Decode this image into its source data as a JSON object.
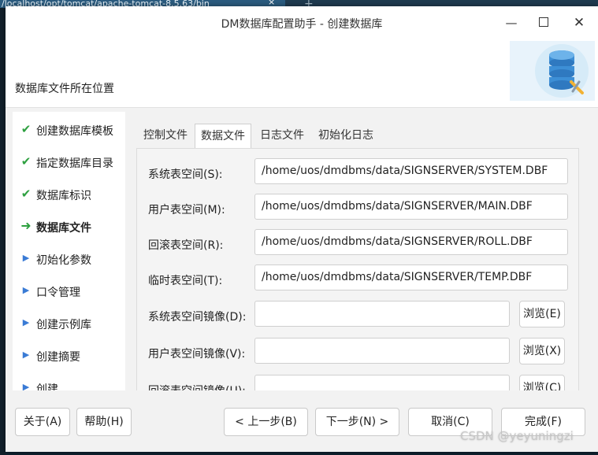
{
  "terminal": {
    "tab_title": "/localhost/opt/tomcat/apache-tomcat-8.5.63/bin",
    "tab_close": "×",
    "new_tab": "+"
  },
  "window": {
    "title": "DM数据库配置助手 - 创建数据库",
    "minimize": "—",
    "close": "✕"
  },
  "header": {
    "label": "数据库文件所在位置"
  },
  "steps": [
    {
      "label": "创建数据库模板",
      "state": "done",
      "icon": "✔"
    },
    {
      "label": "指定数据库目录",
      "state": "done",
      "icon": "✔"
    },
    {
      "label": "数据库标识",
      "state": "done",
      "icon": "✔"
    },
    {
      "label": "数据库文件",
      "state": "current",
      "icon": "➜"
    },
    {
      "label": "初始化参数",
      "state": "todo",
      "icon": "▶"
    },
    {
      "label": "口令管理",
      "state": "todo",
      "icon": "▶"
    },
    {
      "label": "创建示例库",
      "state": "todo",
      "icon": "▶"
    },
    {
      "label": "创建摘要",
      "state": "todo",
      "icon": "▶"
    },
    {
      "label": "创建",
      "state": "todo",
      "icon": "▶"
    }
  ],
  "tabs": [
    {
      "label": "控制文件"
    },
    {
      "label": "数据文件"
    },
    {
      "label": "日志文件"
    },
    {
      "label": "初始化日志"
    }
  ],
  "fields": [
    {
      "label": "系统表空间(S):",
      "value": "/home/uos/dmdbms/data/SIGNSERVER/SYSTEM.DBF"
    },
    {
      "label": "用户表空间(M):",
      "value": "/home/uos/dmdbms/data/SIGNSERVER/MAIN.DBF"
    },
    {
      "label": "回滚表空间(R):",
      "value": "/home/uos/dmdbms/data/SIGNSERVER/ROLL.DBF"
    },
    {
      "label": "临时表空间(T):",
      "value": "/home/uos/dmdbms/data/SIGNSERVER/TEMP.DBF"
    },
    {
      "label": "系统表空间镜像(D):",
      "value": "",
      "browse": "浏览(E)"
    },
    {
      "label": "用户表空间镜像(V):",
      "value": "",
      "browse": "浏览(X)"
    },
    {
      "label": "回滚表空间镜像(U):",
      "value": "",
      "browse": "浏览(C)"
    }
  ],
  "buttons": {
    "about": "关于(A)",
    "help": "帮助(H)",
    "prev": "< 上一步(B)",
    "next": "下一步(N) >",
    "cancel": "取消(C)",
    "finish": "完成(F)"
  },
  "watermark": "CSDN @yeyuningzi",
  "colors": {
    "done_check": "#2ea040",
    "todo_arrow": "#3a7bd5",
    "window_bg": "#f2f2f2"
  }
}
